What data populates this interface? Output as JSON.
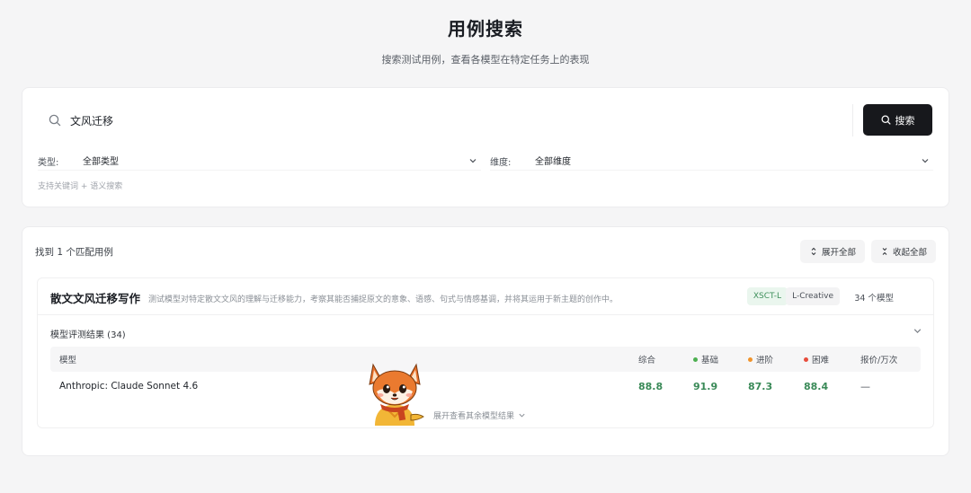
{
  "hero": {
    "title": "用例搜索",
    "subtitle": "搜索测试用例，查看各模型在特定任务上的表现"
  },
  "search": {
    "query": "文风迁移",
    "button_label": "搜索",
    "icon": "search-icon"
  },
  "filters": {
    "type_label": "类型:",
    "type_value": "全部类型",
    "dimension_label": "维度:",
    "dimension_value": "全部维度",
    "hint": "支持关键词 + 语义搜索"
  },
  "results": {
    "count_text": "找到 1 个匹配用例",
    "expand_all_label": "展开全部",
    "collapse_all_label": "收起全部"
  },
  "case": {
    "title": "散文文风迁移写作",
    "description": "测试模型对特定散文文风的理解与迁移能力，考察其能否捕捉原文的意象、语感、句式与情感基调，并将其运用于新主题的创作中。",
    "tags": [
      "XSCT-L",
      "L-Creative"
    ],
    "model_count": "34 个模型",
    "eval_title": "模型评测结果 (34)",
    "more_label": "展开查看其余模型结果"
  },
  "table": {
    "headers": {
      "model": "模型",
      "overall": "综合",
      "basic": "基础",
      "advanced": "进阶",
      "hard": "困难",
      "price": "报价/万次"
    },
    "rows": [
      {
        "model": "Anthropic: Claude Sonnet 4.6",
        "overall": "88.8",
        "basic": "91.9",
        "advanced": "87.3",
        "hard": "88.4",
        "price": "—"
      }
    ]
  },
  "colors": {
    "basic_dot": "#4caf50",
    "advanced_dot": "#f0932b",
    "hard_dot": "#e74c3c",
    "score": "#3a8a58",
    "primary_button": "#17181c",
    "accent_tag": "#eaf6ee"
  },
  "icons": {
    "expand": "expand-arrows-icon",
    "collapse": "collapse-arrows-icon",
    "chevron": "chevron-down-icon",
    "mascot": "fox-mascot"
  }
}
